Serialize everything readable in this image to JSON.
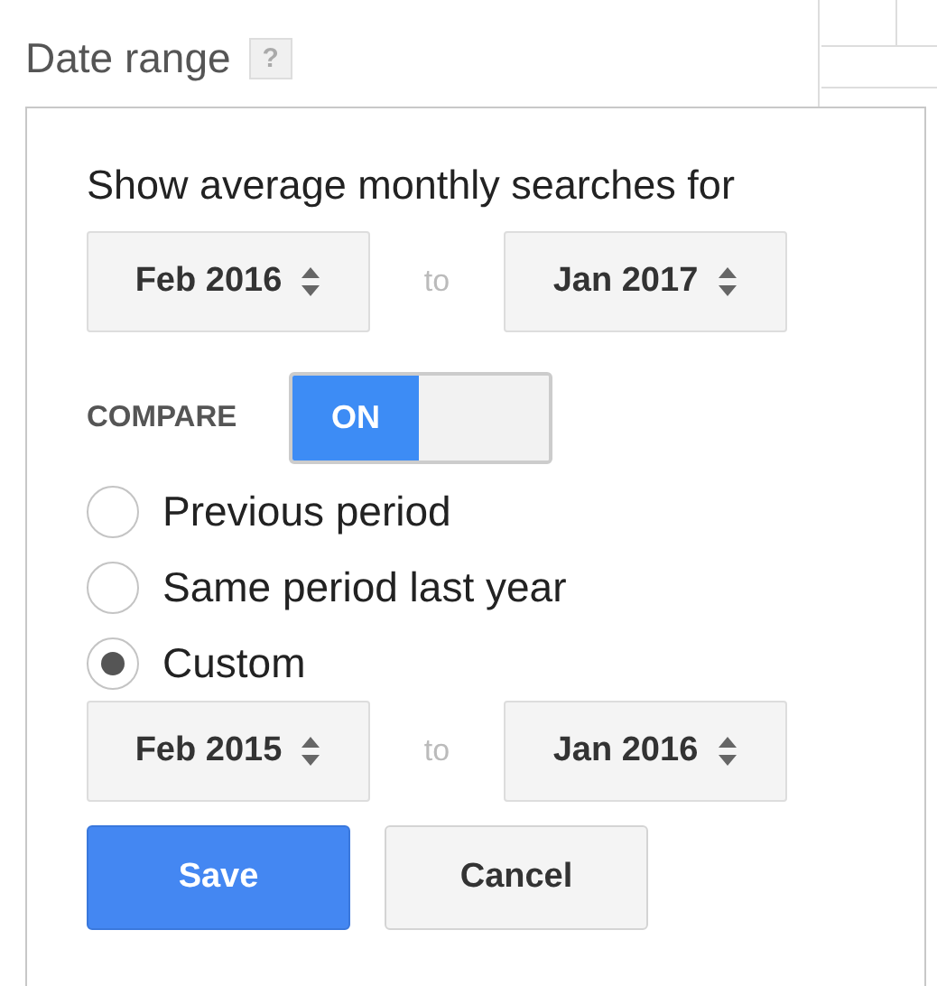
{
  "title": "Date range",
  "help_icon": {
    "label": "?"
  },
  "popup": {
    "heading": "Show average monthly searches for",
    "range": {
      "from": "Feb 2016",
      "separator": "to",
      "to": "Jan 2017"
    },
    "compare": {
      "label": "COMPARE",
      "on": true,
      "on_label": "ON"
    },
    "options": [
      {
        "label": "Previous period",
        "selected": false
      },
      {
        "label": "Same period last year",
        "selected": false
      },
      {
        "label": "Custom",
        "selected": true
      }
    ],
    "compare_range": {
      "from": "Feb 2015",
      "separator": "to",
      "to": "Jan 2016"
    },
    "buttons": [
      {
        "label": "Save",
        "kind": "primary"
      },
      {
        "label": "Cancel",
        "kind": "secondary"
      }
    ]
  }
}
